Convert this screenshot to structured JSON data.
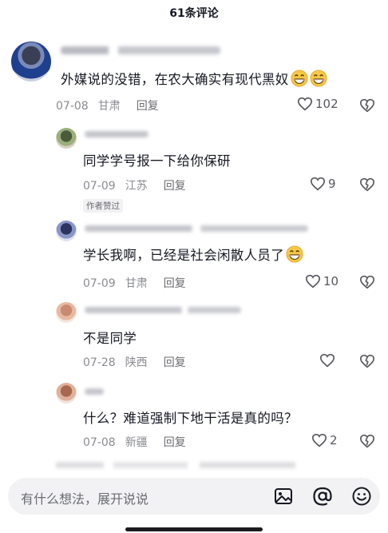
{
  "header": {
    "title": "61条评论"
  },
  "comments": [
    {
      "text": "外媒说的没错，在农大确实有现代黑奴",
      "emoji_count": 2,
      "date": "07-08",
      "location": "甘肃",
      "reply_label": "回复",
      "likes": "102",
      "badge": ""
    },
    {
      "text": "同学学号报一下给你保研",
      "emoji_count": 0,
      "date": "07-09",
      "location": "江苏",
      "reply_label": "回复",
      "likes": "9",
      "badge": "作者赞过"
    },
    {
      "text": "学长我啊，已经是社会闲散人员了",
      "emoji_count": 1,
      "date": "07-09",
      "location": "甘肃",
      "reply_label": "回复",
      "likes": "10",
      "badge": ""
    },
    {
      "text": "不是同学",
      "emoji_count": 0,
      "date": "07-28",
      "location": "陕西",
      "reply_label": "回复",
      "likes": "",
      "badge": ""
    },
    {
      "text": "什么？难道强制下地干活是真的吗？",
      "emoji_count": 0,
      "date": "07-08",
      "location": "新疆",
      "reply_label": "回复",
      "likes": "2",
      "badge": ""
    }
  ],
  "input": {
    "placeholder": "有什么想法，展开说说"
  },
  "icons": {
    "like": "heart-outline-icon",
    "dislike": "broken-heart-icon",
    "image": "image-icon",
    "mention": "at-icon",
    "emoji": "smiley-icon"
  },
  "colors": {
    "text": "#161823",
    "meta": "#8a8b91",
    "input_bg": "#f2f2f4",
    "emoji": "#f6c945"
  }
}
